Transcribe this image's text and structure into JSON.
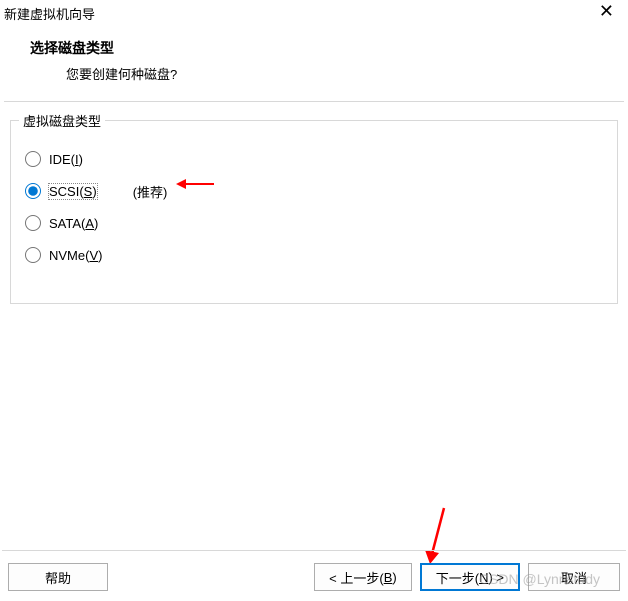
{
  "window": {
    "title": "新建虚拟机向导",
    "close_glyph": "✕"
  },
  "header": {
    "title": "选择磁盘类型",
    "subtitle": "您要创建何种磁盘?"
  },
  "group": {
    "label": "虚拟磁盘类型",
    "options": {
      "ide": {
        "prefix": "IDE(",
        "mnemonic": "I",
        "suffix": ")"
      },
      "scsi": {
        "prefix": "SCSI(",
        "mnemonic": "S",
        "suffix": ")",
        "recommend": "(推荐)"
      },
      "sata": {
        "prefix": "SATA(",
        "mnemonic": "A",
        "suffix": ")"
      },
      "nvme": {
        "prefix": "NVMe(",
        "mnemonic": "V",
        "suffix": ")"
      }
    }
  },
  "footer": {
    "help": "帮助",
    "back_prefix": "< 上一步(",
    "back_mnemonic": "B",
    "back_suffix": ")",
    "next_prefix": "下一步(",
    "next_mnemonic": "N",
    "next_suffix": ") >",
    "cancel": "取消"
  },
  "watermark": "CSDN @Lynnstudy"
}
